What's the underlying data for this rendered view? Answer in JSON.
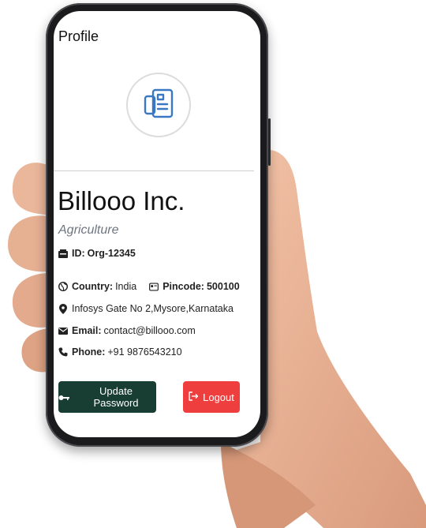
{
  "header": {
    "title": "Profile"
  },
  "company": {
    "name": "Billooo Inc.",
    "industry": "Agriculture",
    "id_label": "ID:",
    "id_value": "Org-12345",
    "country_label": "Country:",
    "country_value": "India",
    "pincode_label": "Pincode:",
    "pincode_value": "500100",
    "address": "Infosys Gate No 2,Mysore,Karnataka",
    "email_label": "Email:",
    "email_value": "contact@billooo.com",
    "phone_label": "Phone:",
    "phone_value": "+91 9876543210"
  },
  "actions": {
    "update_password_label": "Update Password",
    "logout_label": "Logout"
  },
  "icons": {
    "logo": "document-icon",
    "id": "id-card-icon",
    "country": "globe-icon",
    "pincode": "address-card-icon",
    "address": "map-pin-icon",
    "email": "envelope-icon",
    "phone": "phone-icon",
    "update_password": "key-icon",
    "logout": "logout-icon"
  },
  "colors": {
    "update_button": "#183d33",
    "logout_button": "#ee3e3e",
    "logo_icon": "#3b78c3",
    "industry_text": "#6e7680"
  }
}
